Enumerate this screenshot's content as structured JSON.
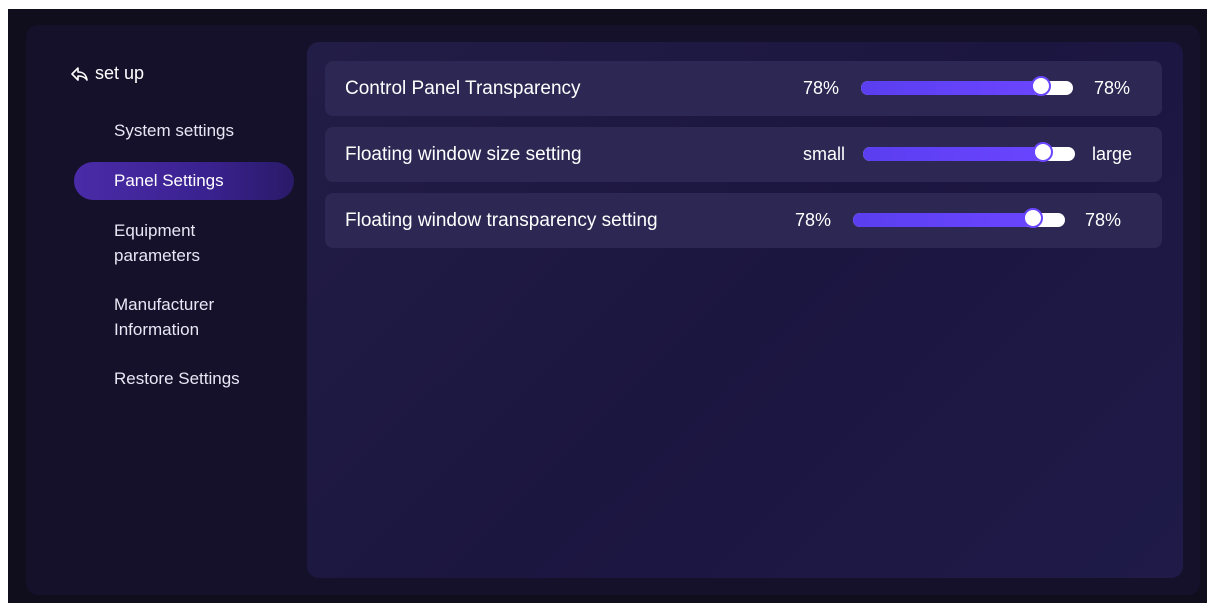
{
  "sidebar": {
    "back_label": "set up",
    "back_icon": "back-arrow-icon",
    "items": [
      {
        "label": "System settings",
        "active": false
      },
      {
        "label": "Panel Settings",
        "active": true
      },
      {
        "label": "Equipment parameters",
        "active": false
      },
      {
        "label": "Manufacturer Information",
        "active": false
      },
      {
        "label": "Restore Settings",
        "active": false
      }
    ]
  },
  "settings": [
    {
      "label": "Control Panel Transparency",
      "min_label": "78%",
      "max_label": "78%",
      "value": 0.85
    },
    {
      "label": "Floating window size setting",
      "min_label": "small",
      "max_label": "large",
      "value": 0.85
    },
    {
      "label": "Floating window transparency setting",
      "min_label": "78%",
      "max_label": "78%",
      "value": 0.85
    }
  ],
  "colors": {
    "accent": "#6a45ff",
    "active_nav": "#3a2290",
    "background": "#15112a",
    "panel": "#1f1a48",
    "row": "#2c2853"
  }
}
